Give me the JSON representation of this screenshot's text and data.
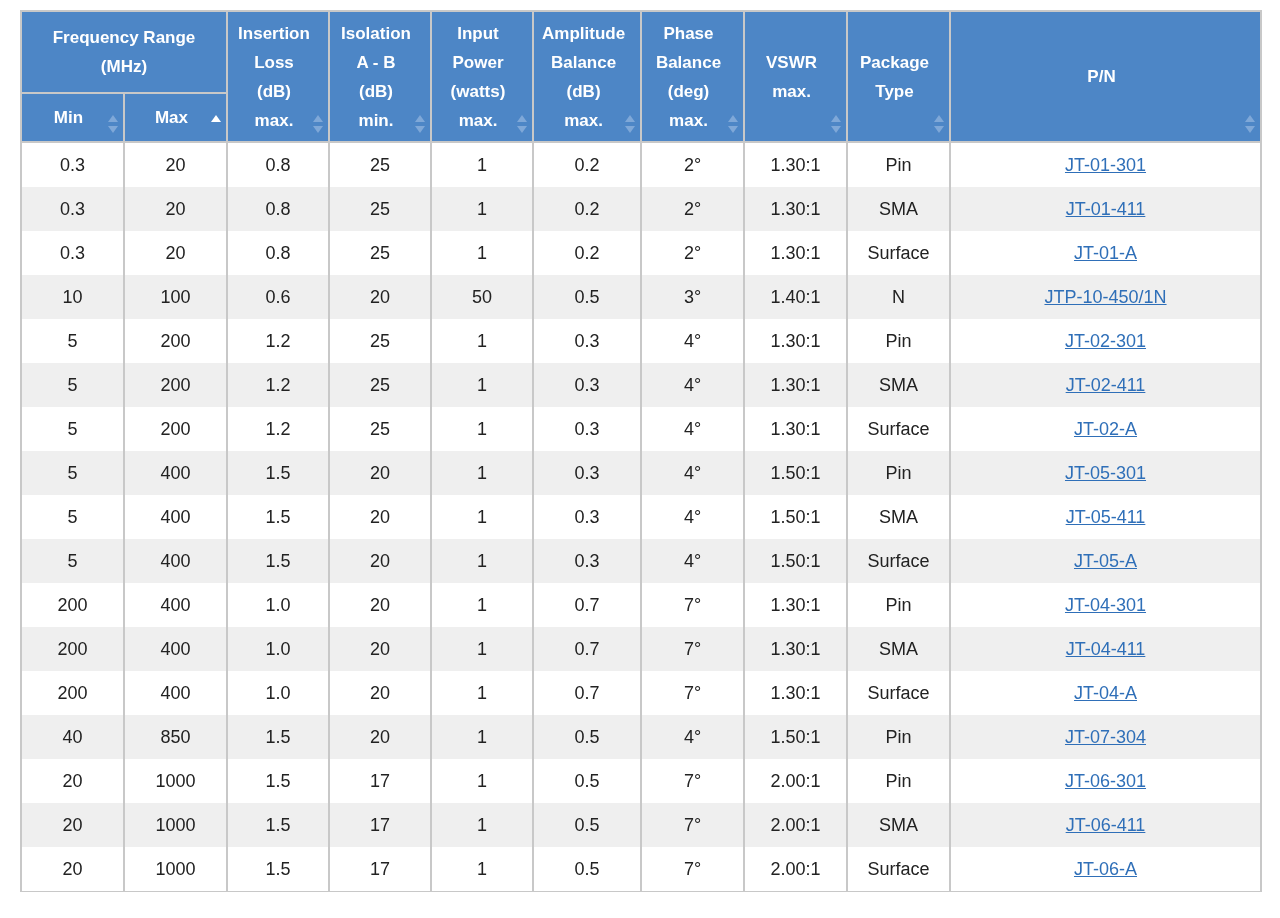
{
  "table": {
    "group": {
      "label": "Frequency Range\n(MHz)"
    },
    "columns": [
      {
        "label": "Min",
        "in_group": true,
        "sorted_ascending": false,
        "kind": "text"
      },
      {
        "label": "Max",
        "in_group": true,
        "sorted_ascending": true,
        "kind": "text"
      },
      {
        "label": "Insertion\nLoss\n(dB)\nmax.",
        "in_group": false,
        "sorted_ascending": false,
        "kind": "text"
      },
      {
        "label": "Isolation\nA - B\n(dB)\nmin.",
        "in_group": false,
        "sorted_ascending": false,
        "kind": "text"
      },
      {
        "label": "Input\nPower\n(watts)\nmax.",
        "in_group": false,
        "sorted_ascending": false,
        "kind": "text"
      },
      {
        "label": "Amplitude\nBalance\n(dB)\nmax.",
        "in_group": false,
        "sorted_ascending": false,
        "kind": "text"
      },
      {
        "label": "Phase\nBalance\n(deg)\nmax.",
        "in_group": false,
        "sorted_ascending": false,
        "kind": "text"
      },
      {
        "label": "VSWR\nmax.",
        "in_group": false,
        "sorted_ascending": false,
        "kind": "text"
      },
      {
        "label": "Package\nType",
        "in_group": false,
        "sorted_ascending": false,
        "kind": "text"
      },
      {
        "label": "P/N",
        "in_group": false,
        "sorted_ascending": false,
        "kind": "link"
      }
    ],
    "rows": [
      [
        "0.3",
        "20",
        "0.8",
        "25",
        "1",
        "0.2",
        "2°",
        "1.30:1",
        "Pin",
        "JT-01-301"
      ],
      [
        "0.3",
        "20",
        "0.8",
        "25",
        "1",
        "0.2",
        "2°",
        "1.30:1",
        "SMA",
        "JT-01-411"
      ],
      [
        "0.3",
        "20",
        "0.8",
        "25",
        "1",
        "0.2",
        "2°",
        "1.30:1",
        "Surface",
        "JT-01-A"
      ],
      [
        "10",
        "100",
        "0.6",
        "20",
        "50",
        "0.5",
        "3°",
        "1.40:1",
        "N",
        "JTP-10-450/1N"
      ],
      [
        "5",
        "200",
        "1.2",
        "25",
        "1",
        "0.3",
        "4°",
        "1.30:1",
        "Pin",
        "JT-02-301"
      ],
      [
        "5",
        "200",
        "1.2",
        "25",
        "1",
        "0.3",
        "4°",
        "1.30:1",
        "SMA",
        "JT-02-411"
      ],
      [
        "5",
        "200",
        "1.2",
        "25",
        "1",
        "0.3",
        "4°",
        "1.30:1",
        "Surface",
        "JT-02-A"
      ],
      [
        "5",
        "400",
        "1.5",
        "20",
        "1",
        "0.3",
        "4°",
        "1.50:1",
        "Pin",
        "JT-05-301"
      ],
      [
        "5",
        "400",
        "1.5",
        "20",
        "1",
        "0.3",
        "4°",
        "1.50:1",
        "SMA",
        "JT-05-411"
      ],
      [
        "5",
        "400",
        "1.5",
        "20",
        "1",
        "0.3",
        "4°",
        "1.50:1",
        "Surface",
        "JT-05-A"
      ],
      [
        "200",
        "400",
        "1.0",
        "20",
        "1",
        "0.7",
        "7°",
        "1.30:1",
        "Pin",
        "JT-04-301"
      ],
      [
        "200",
        "400",
        "1.0",
        "20",
        "1",
        "0.7",
        "7°",
        "1.30:1",
        "SMA",
        "JT-04-411"
      ],
      [
        "200",
        "400",
        "1.0",
        "20",
        "1",
        "0.7",
        "7°",
        "1.30:1",
        "Surface",
        "JT-04-A"
      ],
      [
        "40",
        "850",
        "1.5",
        "20",
        "1",
        "0.5",
        "4°",
        "1.50:1",
        "Pin",
        "JT-07-304"
      ],
      [
        "20",
        "1000",
        "1.5",
        "17",
        "1",
        "0.5",
        "7°",
        "2.00:1",
        "Pin",
        "JT-06-301"
      ],
      [
        "20",
        "1000",
        "1.5",
        "17",
        "1",
        "0.5",
        "7°",
        "2.00:1",
        "SMA",
        "JT-06-411"
      ],
      [
        "20",
        "1000",
        "1.5",
        "17",
        "1",
        "0.5",
        "7°",
        "2.00:1",
        "Surface",
        "JT-06-A"
      ]
    ]
  }
}
